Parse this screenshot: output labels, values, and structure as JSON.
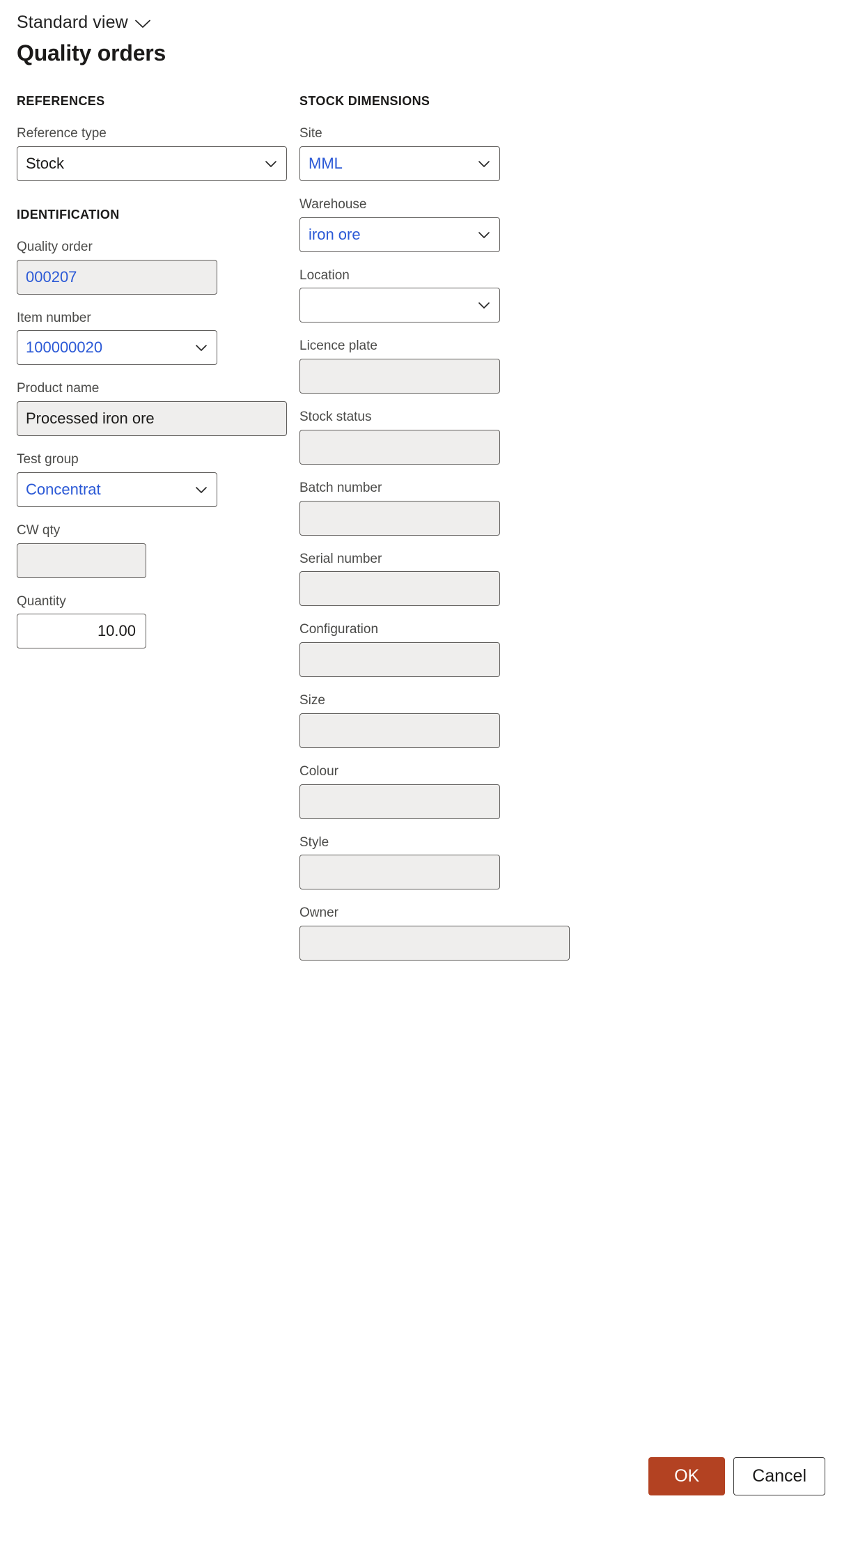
{
  "header": {
    "view_label": "Standard view",
    "view_caret_icon": "chevron-down-icon",
    "title": "Quality orders"
  },
  "left_column": {
    "sections": [
      {
        "heading": "REFERENCES",
        "fields": [
          {
            "label": "Reference type",
            "value": "Stock",
            "style": "wide",
            "type": "combobox",
            "readonly": false,
            "link": false
          }
        ]
      },
      {
        "heading": "IDENTIFICATION",
        "fields": [
          {
            "label": "Quality order",
            "value": "000207",
            "style": "mid",
            "type": "text",
            "readonly": true,
            "link": true
          },
          {
            "label": "Item number",
            "value": "100000020",
            "style": "mid",
            "type": "combobox",
            "readonly": false,
            "link": true
          },
          {
            "label": "Product name",
            "value": "Processed iron ore",
            "style": "wide",
            "type": "text",
            "readonly": true,
            "link": false
          },
          {
            "label": "Test group",
            "value": "Concentrat",
            "style": "mid",
            "type": "combobox",
            "readonly": false,
            "link": true
          },
          {
            "label": "CW qty",
            "value": "",
            "style": "narrow",
            "type": "text",
            "readonly": true,
            "link": false
          },
          {
            "label": "Quantity",
            "value": "10.00",
            "style": "narrow",
            "type": "numeric",
            "readonly": false,
            "link": false
          }
        ]
      }
    ]
  },
  "right_column": {
    "sections": [
      {
        "heading": "STOCK DIMENSIONS",
        "fields": [
          {
            "label": "Site",
            "value": "MML",
            "style": "mid",
            "type": "combobox",
            "readonly": false,
            "link": true
          },
          {
            "label": "Warehouse",
            "value": "iron ore",
            "style": "mid",
            "type": "combobox",
            "readonly": false,
            "link": true
          },
          {
            "label": "Location",
            "value": "",
            "style": "mid",
            "type": "combobox",
            "readonly": false,
            "link": false
          },
          {
            "label": "Licence plate",
            "value": "",
            "style": "mid",
            "type": "text",
            "readonly": true,
            "link": false
          },
          {
            "label": "Stock status",
            "value": "",
            "style": "mid",
            "type": "text",
            "readonly": true,
            "link": false
          },
          {
            "label": "Batch number",
            "value": "",
            "style": "mid",
            "type": "text",
            "readonly": true,
            "link": false
          },
          {
            "label": "Serial number",
            "value": "",
            "style": "mid",
            "type": "text",
            "readonly": true,
            "link": false
          },
          {
            "label": "Configuration",
            "value": "",
            "style": "mid",
            "type": "text",
            "readonly": true,
            "link": false
          },
          {
            "label": "Size",
            "value": "",
            "style": "mid",
            "type": "text",
            "readonly": true,
            "link": false
          },
          {
            "label": "Colour",
            "value": "",
            "style": "mid",
            "type": "text",
            "readonly": true,
            "link": false
          },
          {
            "label": "Style",
            "value": "",
            "style": "mid",
            "type": "text",
            "readonly": true,
            "link": false
          },
          {
            "label": "Owner",
            "value": "",
            "style": "owner",
            "type": "text",
            "readonly": true,
            "link": false
          }
        ]
      }
    ]
  },
  "footer": {
    "ok_label": "OK",
    "cancel_label": "Cancel"
  },
  "colors": {
    "primary_button": "#b34222",
    "link_text": "#2b59d6",
    "readonly_background": "#efeeed",
    "border": "#605e5c"
  }
}
